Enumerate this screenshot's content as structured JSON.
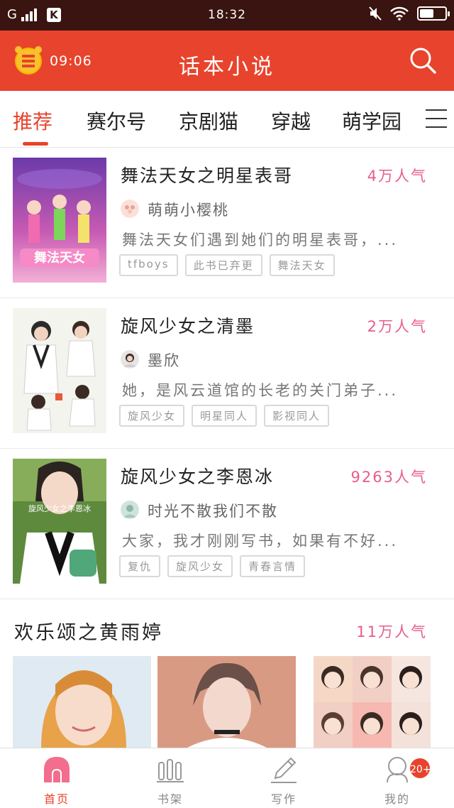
{
  "status_bar": {
    "carrier": "G",
    "app_badge": "K",
    "time": "18:32",
    "battery_level": 0.55
  },
  "header": {
    "alarm_time": "09:06",
    "title": "话本小说"
  },
  "tabs": [
    {
      "label": "推荐",
      "active": true
    },
    {
      "label": "赛尔号",
      "active": false
    },
    {
      "label": "京剧猫",
      "active": false
    },
    {
      "label": "穿越",
      "active": false
    },
    {
      "label": "萌学园",
      "active": false
    }
  ],
  "books": [
    {
      "title": "舞法天女之明星表哥",
      "popularity": "4万人气",
      "author": "萌萌小樱桃",
      "description": "舞法天女们遇到她们的明星表哥，...",
      "tags": [
        "tfboys",
        "此书已弃更",
        "舞法天女"
      ],
      "cover_text": "舞法天女"
    },
    {
      "title": "旋风少女之清墨",
      "popularity": "2万人气",
      "author": "墨欣",
      "description": "她，是风云道馆的长老的关门弟子...",
      "tags": [
        "旋风少女",
        "明星同人",
        "影视同人"
      ],
      "cover_text": ""
    },
    {
      "title": "旋风少女之李恩冰",
      "popularity": "9263人气",
      "author": "时光不散我们不散",
      "description": "大家，我才刚刚写书，如果有不好...",
      "tags": [
        "复仇",
        "旋风少女",
        "青春言情"
      ],
      "cover_text": "旋风少女之李恩冰"
    }
  ],
  "featured": {
    "title": "欢乐颂之黄雨婷",
    "popularity": "11万人气"
  },
  "bottom_nav": [
    {
      "label": "首页",
      "icon": "home-icon",
      "active": true
    },
    {
      "label": "书架",
      "icon": "bookshelf-icon",
      "active": false
    },
    {
      "label": "写作",
      "icon": "pen-icon",
      "active": false
    },
    {
      "label": "我的",
      "icon": "profile-icon",
      "active": false,
      "badge": "20+"
    }
  ],
  "colors": {
    "accent": "#e8432c",
    "popularity": "#e75d8a",
    "status_bar": "#3a1410"
  }
}
